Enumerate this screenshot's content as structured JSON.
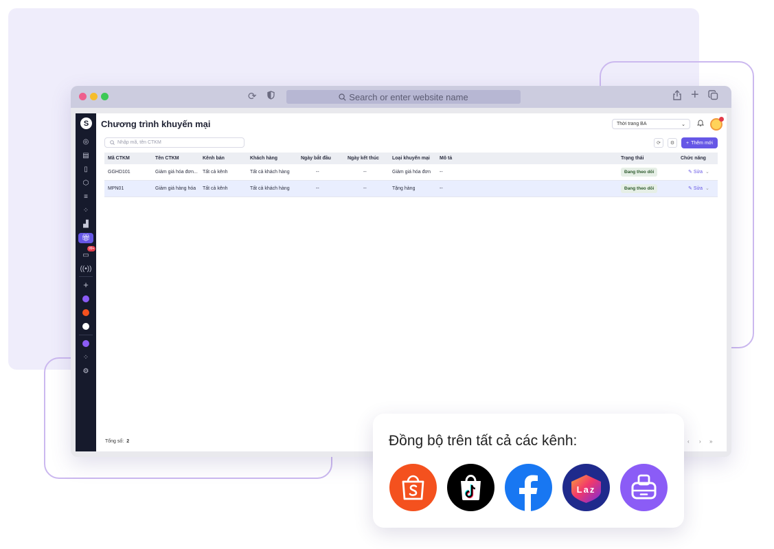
{
  "browser": {
    "url_placeholder": "Search or enter website name"
  },
  "app": {
    "title": "Chương trình khuyến mại",
    "store_select": "Thời trang BA",
    "sidebar_badge": "99+",
    "search_placeholder": "Nhập mã, tên CTKM",
    "add_button": "Thêm mới",
    "columns": [
      "Mã CTKM",
      "Tên CTKM",
      "Kênh bán",
      "Khách hàng",
      "Ngày bắt đầu",
      "Ngày kết thúc",
      "Loại khuyến mại",
      "Mô tả",
      "Trạng thái",
      "Chức năng"
    ],
    "rows": [
      {
        "code": "GGHD101",
        "name": "Giảm giá hóa đơn...",
        "channel": "Tất cả kênh",
        "customer": "Tất cả khách hàng",
        "start": "--",
        "end": "--",
        "type": "Giảm giá hóa đơn",
        "desc": "--",
        "status": "Đang theo dõi",
        "action": "Sửa"
      },
      {
        "code": "MPN01",
        "name": "Giảm giá hàng hóa",
        "channel": "Tất cả kênh",
        "customer": "Tất cả khách hàng",
        "start": "--",
        "end": "--",
        "type": "Tặng hàng",
        "desc": "--",
        "status": "Đang theo dõi",
        "action": "Sửa"
      }
    ],
    "total_label": "Tổng số:",
    "total_value": "2"
  },
  "sync": {
    "title": "Đồng bộ trên tất cả các kênh:",
    "channels": [
      {
        "icon": "shopee-icon",
        "color": "#f4511e"
      },
      {
        "icon": "tiktok-shop-icon",
        "color": "#000000"
      },
      {
        "icon": "facebook-icon",
        "color": "#1877f2"
      },
      {
        "icon": "lazada-icon",
        "color": "#1f2a8c"
      },
      {
        "icon": "pos-app-icon",
        "color": "#8b5cf6"
      }
    ],
    "lazada_text": "Laz"
  },
  "colors": {
    "accent": "#6657e6",
    "sidebar": "#161a2c"
  }
}
